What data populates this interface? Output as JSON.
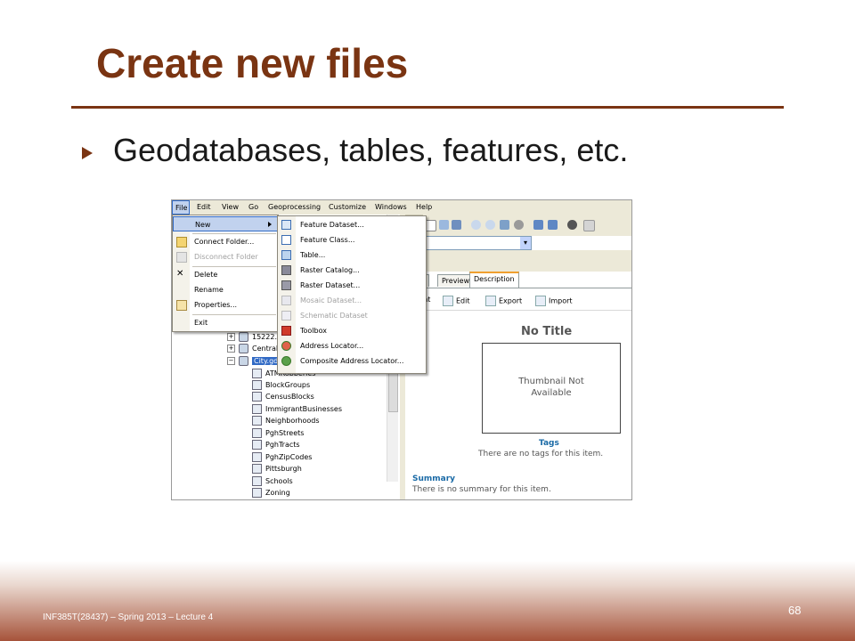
{
  "slide": {
    "title": "Create new files",
    "bullet": "Geodatabases, tables, features, etc.",
    "footer": "INF385T(28437) – Spring 2013 – Lecture 4",
    "page_number": "68",
    "accent_color": "#7a3412"
  },
  "app": {
    "menubar": [
      "File",
      "Edit",
      "View",
      "Go",
      "Geoprocessing",
      "Customize",
      "Windows",
      "Help"
    ],
    "file_menu": {
      "items": [
        {
          "label": "New",
          "icon": "none",
          "highlighted": true,
          "submenu": true
        },
        {
          "label": "Connect Folder...",
          "icon": "connect-folder-icon"
        },
        {
          "label": "Disconnect Folder",
          "icon": "disconnect-folder-icon",
          "disabled": true
        },
        {
          "label": "Delete",
          "icon": "delete-x-icon"
        },
        {
          "label": "Rename",
          "icon": "none"
        },
        {
          "label": "Properties...",
          "icon": "properties-icon"
        },
        {
          "label": "Exit",
          "icon": "none"
        }
      ]
    },
    "new_submenu": {
      "items": [
        {
          "label": "Feature Dataset...",
          "icon": "feature-dataset-icon"
        },
        {
          "label": "Feature Class...",
          "icon": "feature-class-icon"
        },
        {
          "label": "Table...",
          "icon": "table-icon"
        },
        {
          "label": "Raster Catalog...",
          "icon": "raster-catalog-icon"
        },
        {
          "label": "Raster Dataset...",
          "icon": "raster-dataset-icon"
        },
        {
          "label": "Mosaic Dataset...",
          "icon": "mosaic-dataset-icon",
          "disabled": true
        },
        {
          "label": "Schematic Dataset",
          "icon": "schematic-dataset-icon",
          "disabled": true
        },
        {
          "label": "Toolbox",
          "icon": "toolbox-icon"
        },
        {
          "label": "Address Locator...",
          "icon": "address-locator-icon"
        },
        {
          "label": "Composite Address Locator...",
          "icon": "composite-address-locator-icon"
        }
      ]
    },
    "tree": {
      "rows": [
        {
          "label": "15222.",
          "type": "gdb",
          "expand": "+"
        },
        {
          "label": "Central",
          "type": "gdb",
          "expand": "+"
        },
        {
          "label": "City.gd",
          "type": "gdb",
          "expand": "−",
          "selected": true
        },
        {
          "label": "ATMRobberies",
          "type": "point"
        },
        {
          "label": "BlockGroups",
          "type": "poly"
        },
        {
          "label": "CensusBlocks",
          "type": "poly"
        },
        {
          "label": "ImmigrantBusinesses",
          "type": "poly"
        },
        {
          "label": "Neighborhoods",
          "type": "poly"
        },
        {
          "label": "PghStreets",
          "type": "line"
        },
        {
          "label": "PghTracts",
          "type": "poly"
        },
        {
          "label": "PghZipCodes",
          "type": "poly"
        },
        {
          "label": "Pittsburgh",
          "type": "poly"
        },
        {
          "label": "Schools",
          "type": "point"
        },
        {
          "label": "Zoning",
          "type": "poly"
        }
      ]
    },
    "tabs": [
      "ents",
      "Preview",
      "Description"
    ],
    "active_tab": "Description",
    "desc_toolbar": [
      "Print",
      "Edit",
      "Export",
      "Import"
    ],
    "description": {
      "title": "No Title",
      "thumbnail_text_1": "Thumbnail Not",
      "thumbnail_text_2": "Available",
      "tags_heading": "Tags",
      "tags_text": "There are no tags for this item.",
      "summary_heading": "Summary",
      "summary_text": "There is no summary for this item."
    }
  }
}
